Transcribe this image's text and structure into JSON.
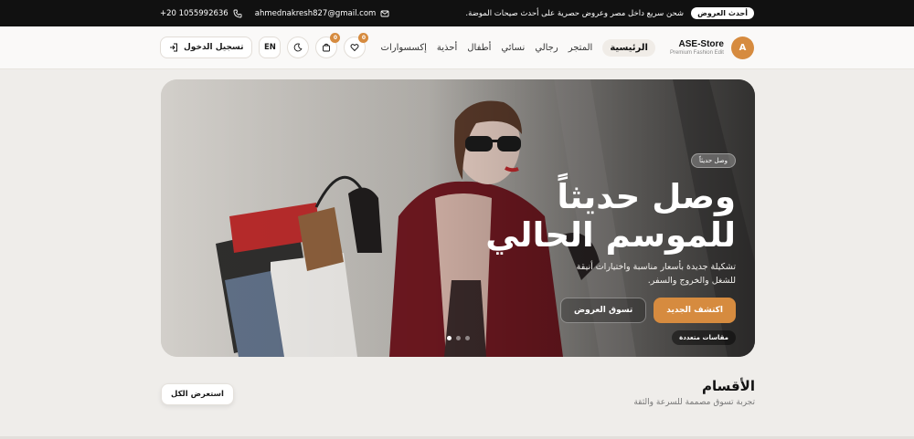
{
  "topbar": {
    "phone": "+20 1055992636",
    "email": "ahmednakresh827@gmail.com",
    "promo_text": "شحن سريع داخل مصر وعروض حصرية على أحدث صيحات الموضة.",
    "badge": "أحدث العروض"
  },
  "header": {
    "login_label": "تسجيل الدخول",
    "lang_label": "EN",
    "cart_count": "0",
    "wishlist_count": "0",
    "nav": [
      "الرئيسية",
      "المتجر",
      "رجالي",
      "نسائي",
      "أطفال",
      "أحذية",
      "إكسسوارات"
    ],
    "brand_name": "ASE-Store",
    "brand_tagline": "Premium Fashion Edit",
    "logo_letter": "A"
  },
  "hero": {
    "pill": "وصل حديثاً",
    "headline_line1": "وصل حديثاً",
    "headline_line2": "للموسم الحالي",
    "subtitle": "تشكيلة جديدة بأسعار مناسبة واختيارات أنيقة للشغل والخروج والسفر.",
    "cta_primary": "اكتشف الجديد",
    "cta_secondary": "تسوق العروض",
    "chip": "مقاسات متعددة",
    "slides": 3,
    "active_slide": 1
  },
  "categories": {
    "title": "الأقسام",
    "subtitle": "تجربة تسوق مصممة للسرعة والثقة",
    "view_all": "استعرض الكل"
  },
  "colors": {
    "accent": "#d68b3f",
    "topbar_bg": "#111111",
    "page_bg": "#efedea"
  }
}
